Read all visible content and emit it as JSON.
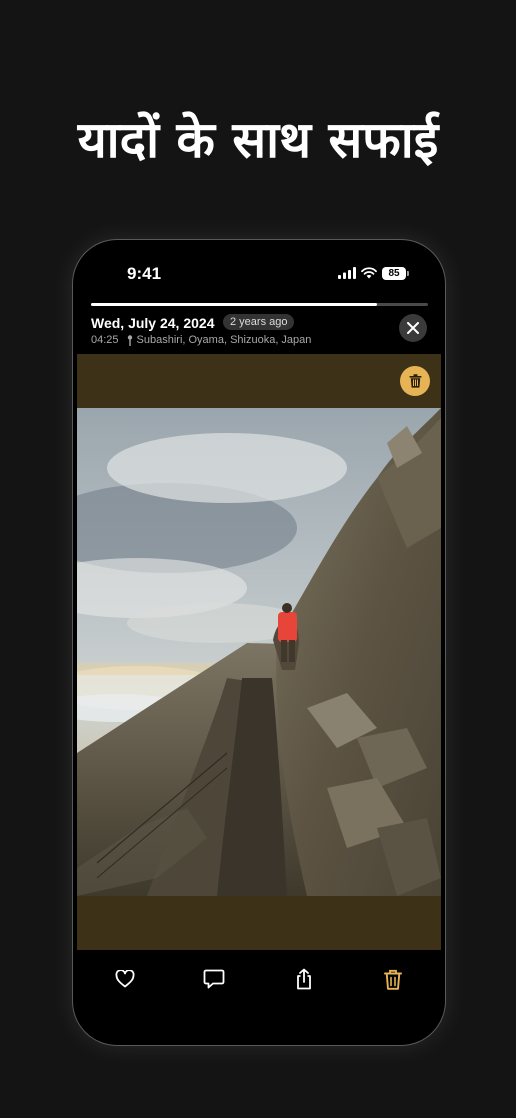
{
  "headline": "यादों के साथ सफाई",
  "status_bar": {
    "time": "9:41",
    "battery": "85",
    "icons": [
      "signal-icon",
      "wifi-icon",
      "battery-icon"
    ]
  },
  "viewer": {
    "progress": 0.85,
    "date": "Wed, July 24, 2024",
    "relative_time": "2 years ago",
    "time": "04:25",
    "location": "Subashiri, Oyama, Shizuoka, Japan",
    "photo_background": "#3d3218"
  },
  "toolbar": {
    "buttons": [
      "heart-icon",
      "comment-icon",
      "share-icon",
      "trash-icon"
    ],
    "accent": "#e6b455"
  }
}
